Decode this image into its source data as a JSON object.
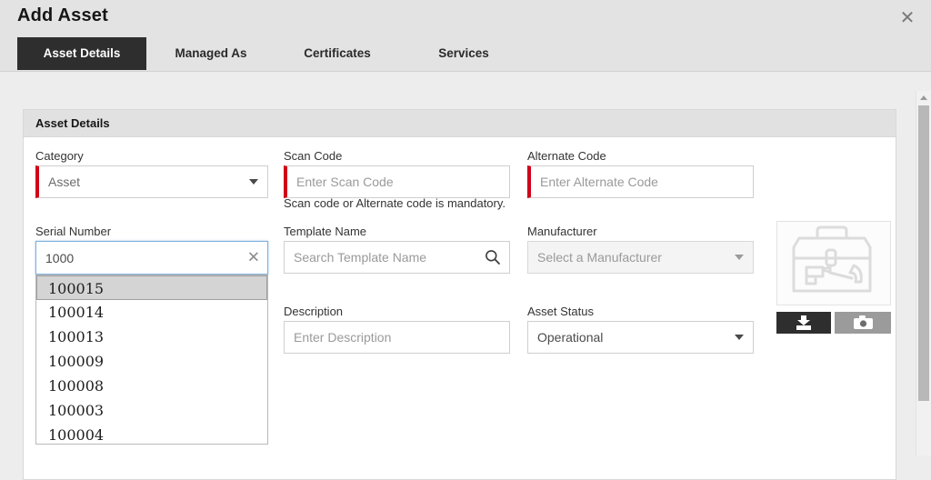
{
  "header": {
    "title": "Add Asset",
    "close_icon": "close-icon"
  },
  "tabs": [
    {
      "label": "Asset Details",
      "active": true
    },
    {
      "label": "Managed As",
      "active": false
    },
    {
      "label": "Certificates",
      "active": false
    },
    {
      "label": "Services",
      "active": false
    }
  ],
  "panel": {
    "heading": "Asset Details"
  },
  "fields": {
    "category": {
      "label": "Category",
      "value": "Asset",
      "required": true,
      "icon": "chevron-down-icon"
    },
    "scan_code": {
      "label": "Scan Code",
      "placeholder": "Enter Scan Code",
      "value": "",
      "required": true
    },
    "alternate_code": {
      "label": "Alternate Code",
      "placeholder": "Enter Alternate Code",
      "value": "",
      "required": true
    },
    "mandatory_note": "Scan code or Alternate code is mandatory.",
    "serial_number": {
      "label": "Serial Number",
      "value": "1000",
      "clear_icon": "close-icon",
      "focused": true
    },
    "template_name": {
      "label": "Template Name",
      "placeholder": "Search Template Name",
      "value": "",
      "icon": "search-icon"
    },
    "manufacturer": {
      "label": "Manufacturer",
      "placeholder": "Select a Manufacturer",
      "value": "",
      "icon": "chevron-down-icon",
      "disabled": true
    },
    "description": {
      "label": "Description",
      "placeholder": "Enter Description",
      "value": ""
    },
    "asset_status": {
      "label": "Asset Status",
      "value": "Operational",
      "icon": "chevron-down-icon"
    }
  },
  "serial_suggestions": [
    {
      "value": "100015",
      "selected": true
    },
    {
      "value": "100014",
      "selected": false
    },
    {
      "value": "100013",
      "selected": false
    },
    {
      "value": "100009",
      "selected": false
    },
    {
      "value": "100008",
      "selected": false
    },
    {
      "value": "100003",
      "selected": false
    },
    {
      "value": "100004",
      "selected": false
    }
  ],
  "image_panel": {
    "placeholder_icon": "toolbox-icon",
    "upload_button_icon": "upload-icon",
    "capture_button_icon": "camera-icon"
  },
  "scrollbar": {
    "up_arrow_icon": "chevron-up-icon"
  },
  "colors": {
    "required_marker": "#d0021b",
    "active_tab_bg": "#2e2e2e",
    "page_bg": "#ededed",
    "focus_border": "#7fb2dd"
  }
}
